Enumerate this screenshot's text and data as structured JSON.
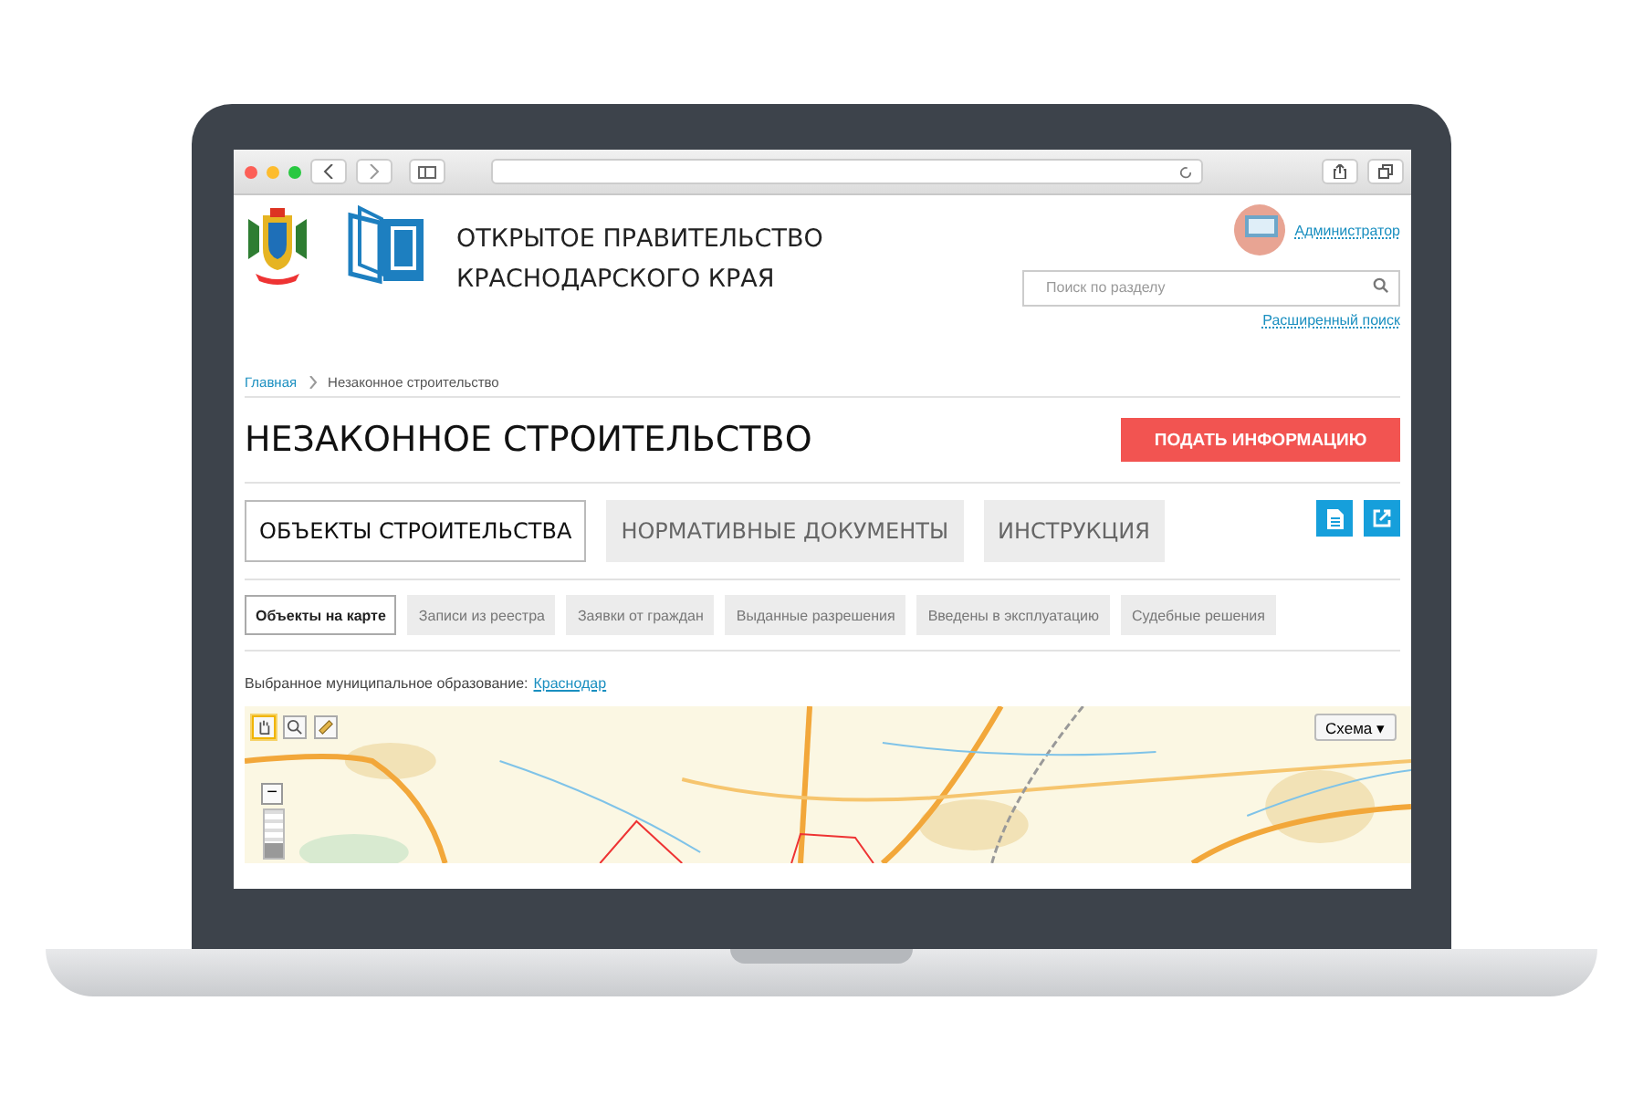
{
  "header": {
    "title_lines": [
      "ОТКРЫТОЕ ПРАВИТЕЛЬСТВО",
      "КРАСНОДАРСКОГО КРАЯ"
    ],
    "user": "Администратор",
    "search": {
      "placeholder": "Поиск по разделу"
    },
    "advanced_search": "Расширенный поиск"
  },
  "breadcrumbs": [
    {
      "label": "Главная",
      "selected": false
    },
    {
      "label": "Незаконное строительство",
      "selected": true
    }
  ],
  "page_title": "НЕЗАКОННОЕ СТРОИТЕЛЬСТВО",
  "report_button": "ПОДАТЬ ИНФОРМАЦИЮ",
  "tabs": [
    {
      "label": "ОБЪЕКТЫ СТРОИТЕЛЬСТВА",
      "selected": true
    },
    {
      "label": "НОРМАТИВНЫЕ ДОКУМЕНТЫ",
      "selected": false
    },
    {
      "label": "ИНСТРУКЦИЯ",
      "selected": false
    }
  ],
  "subtabs": [
    {
      "label": "Объекты на карте",
      "selected": true
    },
    {
      "label": "Записи из реестра",
      "selected": false
    },
    {
      "label": "Заявки от граждан",
      "selected": false
    },
    {
      "label": "Выданные разрешения",
      "selected": false
    },
    {
      "label": "Введены в эксплуатацию",
      "selected": false
    },
    {
      "label": "Судебные решения",
      "selected": false
    }
  ],
  "municipality": {
    "label": "Выбранное муниципальное образование:",
    "link": "Краснодар"
  },
  "map": {
    "layer_button": "Схема ▾",
    "tools": [
      {
        "kind": "hand",
        "selected": true
      },
      {
        "kind": "zoom",
        "selected": false
      },
      {
        "kind": "ruler",
        "selected": false
      }
    ],
    "zoom_out": "−",
    "zoom": {
      "level": 0.3
    }
  }
}
